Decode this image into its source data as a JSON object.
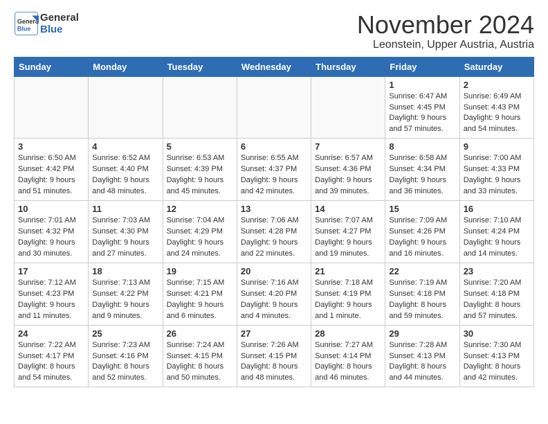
{
  "header": {
    "logo_line1": "General",
    "logo_line2": "Blue",
    "month_title": "November 2024",
    "location": "Leonstein, Upper Austria, Austria"
  },
  "weekdays": [
    "Sunday",
    "Monday",
    "Tuesday",
    "Wednesday",
    "Thursday",
    "Friday",
    "Saturday"
  ],
  "weeks": [
    [
      {
        "day": "",
        "info": ""
      },
      {
        "day": "",
        "info": ""
      },
      {
        "day": "",
        "info": ""
      },
      {
        "day": "",
        "info": ""
      },
      {
        "day": "",
        "info": ""
      },
      {
        "day": "1",
        "info": "Sunrise: 6:47 AM\nSunset: 4:45 PM\nDaylight: 9 hours\nand 57 minutes."
      },
      {
        "day": "2",
        "info": "Sunrise: 6:49 AM\nSunset: 4:43 PM\nDaylight: 9 hours\nand 54 minutes."
      }
    ],
    [
      {
        "day": "3",
        "info": "Sunrise: 6:50 AM\nSunset: 4:42 PM\nDaylight: 9 hours\nand 51 minutes."
      },
      {
        "day": "4",
        "info": "Sunrise: 6:52 AM\nSunset: 4:40 PM\nDaylight: 9 hours\nand 48 minutes."
      },
      {
        "day": "5",
        "info": "Sunrise: 6:53 AM\nSunset: 4:39 PM\nDaylight: 9 hours\nand 45 minutes."
      },
      {
        "day": "6",
        "info": "Sunrise: 6:55 AM\nSunset: 4:37 PM\nDaylight: 9 hours\nand 42 minutes."
      },
      {
        "day": "7",
        "info": "Sunrise: 6:57 AM\nSunset: 4:36 PM\nDaylight: 9 hours\nand 39 minutes."
      },
      {
        "day": "8",
        "info": "Sunrise: 6:58 AM\nSunset: 4:34 PM\nDaylight: 9 hours\nand 36 minutes."
      },
      {
        "day": "9",
        "info": "Sunrise: 7:00 AM\nSunset: 4:33 PM\nDaylight: 9 hours\nand 33 minutes."
      }
    ],
    [
      {
        "day": "10",
        "info": "Sunrise: 7:01 AM\nSunset: 4:32 PM\nDaylight: 9 hours\nand 30 minutes."
      },
      {
        "day": "11",
        "info": "Sunrise: 7:03 AM\nSunset: 4:30 PM\nDaylight: 9 hours\nand 27 minutes."
      },
      {
        "day": "12",
        "info": "Sunrise: 7:04 AM\nSunset: 4:29 PM\nDaylight: 9 hours\nand 24 minutes."
      },
      {
        "day": "13",
        "info": "Sunrise: 7:06 AM\nSunset: 4:28 PM\nDaylight: 9 hours\nand 22 minutes."
      },
      {
        "day": "14",
        "info": "Sunrise: 7:07 AM\nSunset: 4:27 PM\nDaylight: 9 hours\nand 19 minutes."
      },
      {
        "day": "15",
        "info": "Sunrise: 7:09 AM\nSunset: 4:26 PM\nDaylight: 9 hours\nand 16 minutes."
      },
      {
        "day": "16",
        "info": "Sunrise: 7:10 AM\nSunset: 4:24 PM\nDaylight: 9 hours\nand 14 minutes."
      }
    ],
    [
      {
        "day": "17",
        "info": "Sunrise: 7:12 AM\nSunset: 4:23 PM\nDaylight: 9 hours\nand 11 minutes."
      },
      {
        "day": "18",
        "info": "Sunrise: 7:13 AM\nSunset: 4:22 PM\nDaylight: 9 hours\nand 9 minutes."
      },
      {
        "day": "19",
        "info": "Sunrise: 7:15 AM\nSunset: 4:21 PM\nDaylight: 9 hours\nand 6 minutes."
      },
      {
        "day": "20",
        "info": "Sunrise: 7:16 AM\nSunset: 4:20 PM\nDaylight: 9 hours\nand 4 minutes."
      },
      {
        "day": "21",
        "info": "Sunrise: 7:18 AM\nSunset: 4:19 PM\nDaylight: 9 hours\nand 1 minute."
      },
      {
        "day": "22",
        "info": "Sunrise: 7:19 AM\nSunset: 4:18 PM\nDaylight: 8 hours\nand 59 minutes."
      },
      {
        "day": "23",
        "info": "Sunrise: 7:20 AM\nSunset: 4:18 PM\nDaylight: 8 hours\nand 57 minutes."
      }
    ],
    [
      {
        "day": "24",
        "info": "Sunrise: 7:22 AM\nSunset: 4:17 PM\nDaylight: 8 hours\nand 54 minutes."
      },
      {
        "day": "25",
        "info": "Sunrise: 7:23 AM\nSunset: 4:16 PM\nDaylight: 8 hours\nand 52 minutes."
      },
      {
        "day": "26",
        "info": "Sunrise: 7:24 AM\nSunset: 4:15 PM\nDaylight: 8 hours\nand 50 minutes."
      },
      {
        "day": "27",
        "info": "Sunrise: 7:26 AM\nSunset: 4:15 PM\nDaylight: 8 hours\nand 48 minutes."
      },
      {
        "day": "28",
        "info": "Sunrise: 7:27 AM\nSunset: 4:14 PM\nDaylight: 8 hours\nand 46 minutes."
      },
      {
        "day": "29",
        "info": "Sunrise: 7:28 AM\nSunset: 4:13 PM\nDaylight: 8 hours\nand 44 minutes."
      },
      {
        "day": "30",
        "info": "Sunrise: 7:30 AM\nSunset: 4:13 PM\nDaylight: 8 hours\nand 42 minutes."
      }
    ]
  ]
}
